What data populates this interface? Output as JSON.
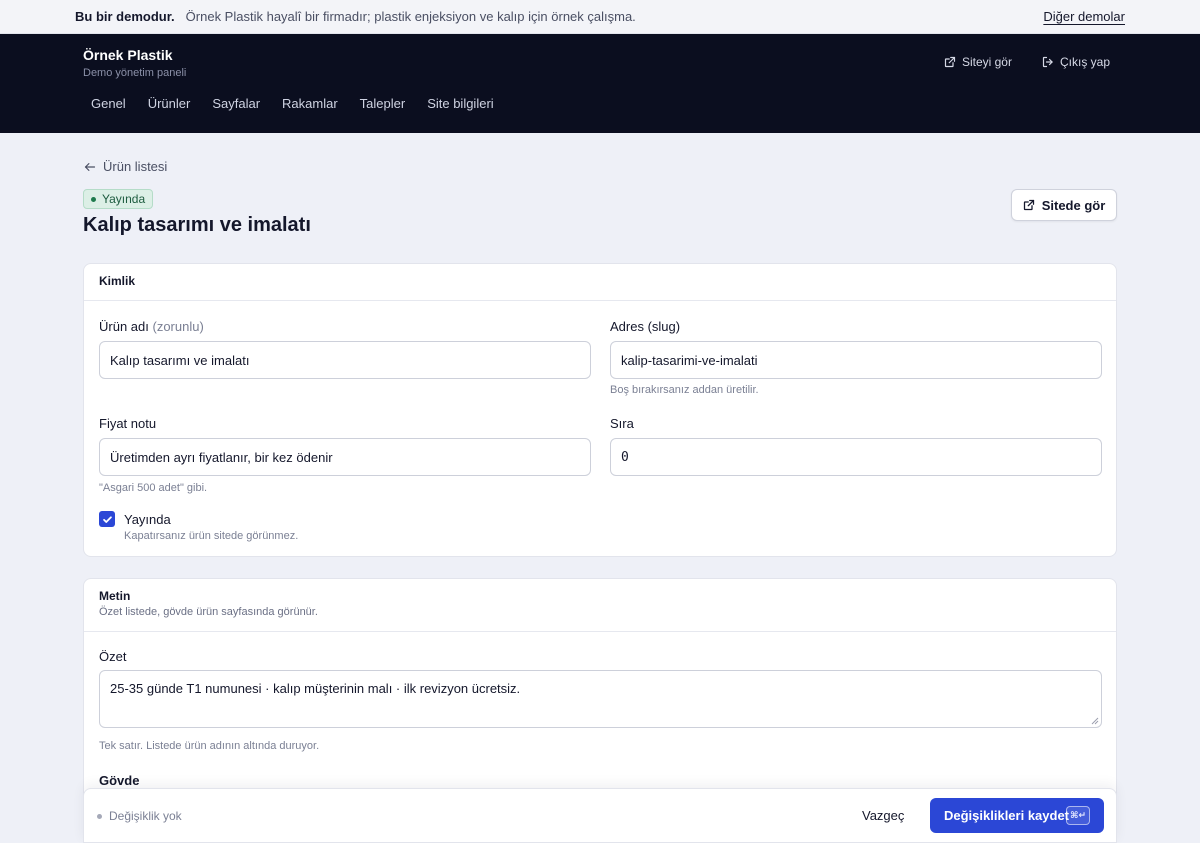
{
  "demo_bar": {
    "title": "Bu bir demodur.",
    "description": "Örnek Plastik hayalî bir firmadır; plastik enjeksiyon ve kalıp için örnek çalışma.",
    "other_demos": "Diğer demolar"
  },
  "header": {
    "brand": "Örnek Plastik",
    "subtitle": "Demo yönetim paneli",
    "view_site": "Siteyi gör",
    "logout": "Çıkış yap",
    "tabs": [
      "Genel",
      "Ürünler",
      "Sayfalar",
      "Rakamlar",
      "Talepler",
      "Site bilgileri"
    ]
  },
  "page": {
    "back_link": "Ürün listesi",
    "status_badge": "Yayında",
    "title": "Kalıp tasarımı ve imalatı",
    "view_on_site": "Sitede gör"
  },
  "identity": {
    "heading": "Kimlik",
    "name_label": "Ürün adı",
    "name_required": "(zorunlu)",
    "name_value": "Kalıp tasarımı ve imalatı",
    "slug_label": "Adres (slug)",
    "slug_value": "kalip-tasarimi-ve-imalati",
    "slug_hint": "Boş bırakırsanız addan üretilir.",
    "price_label": "Fiyat notu",
    "price_value": "Üretimden ayrı fiyatlanır, bir kez ödenir",
    "price_hint": "\"Asgari 500 adet\" gibi.",
    "order_label": "Sıra",
    "order_value": "0",
    "published_label": "Yayında",
    "published_checked": true,
    "published_hint": "Kapatırsanız ürün sitede görünmez."
  },
  "text_section": {
    "heading": "Metin",
    "subheading": "Özet listede, gövde ürün sayfasında görünür.",
    "summary_label": "Özet",
    "summary_value": "25-35 günde T1 numunesi · kalıp müşterinin malı · ilk revizyon ücretsiz.",
    "summary_hint": "Tek satır. Listede ürün adının altında duruyor.",
    "body_label": "Gövde"
  },
  "footer": {
    "status": "Değişiklik yok",
    "cancel": "Vazgeç",
    "save": "Değişiklikleri kaydet",
    "shortcut": "⌘↵"
  },
  "colors": {
    "primary": "#2b47d6",
    "nav_bg": "#0b0e1f",
    "page_bg": "#eef0f7",
    "badge_bg": "#dcefe6"
  }
}
